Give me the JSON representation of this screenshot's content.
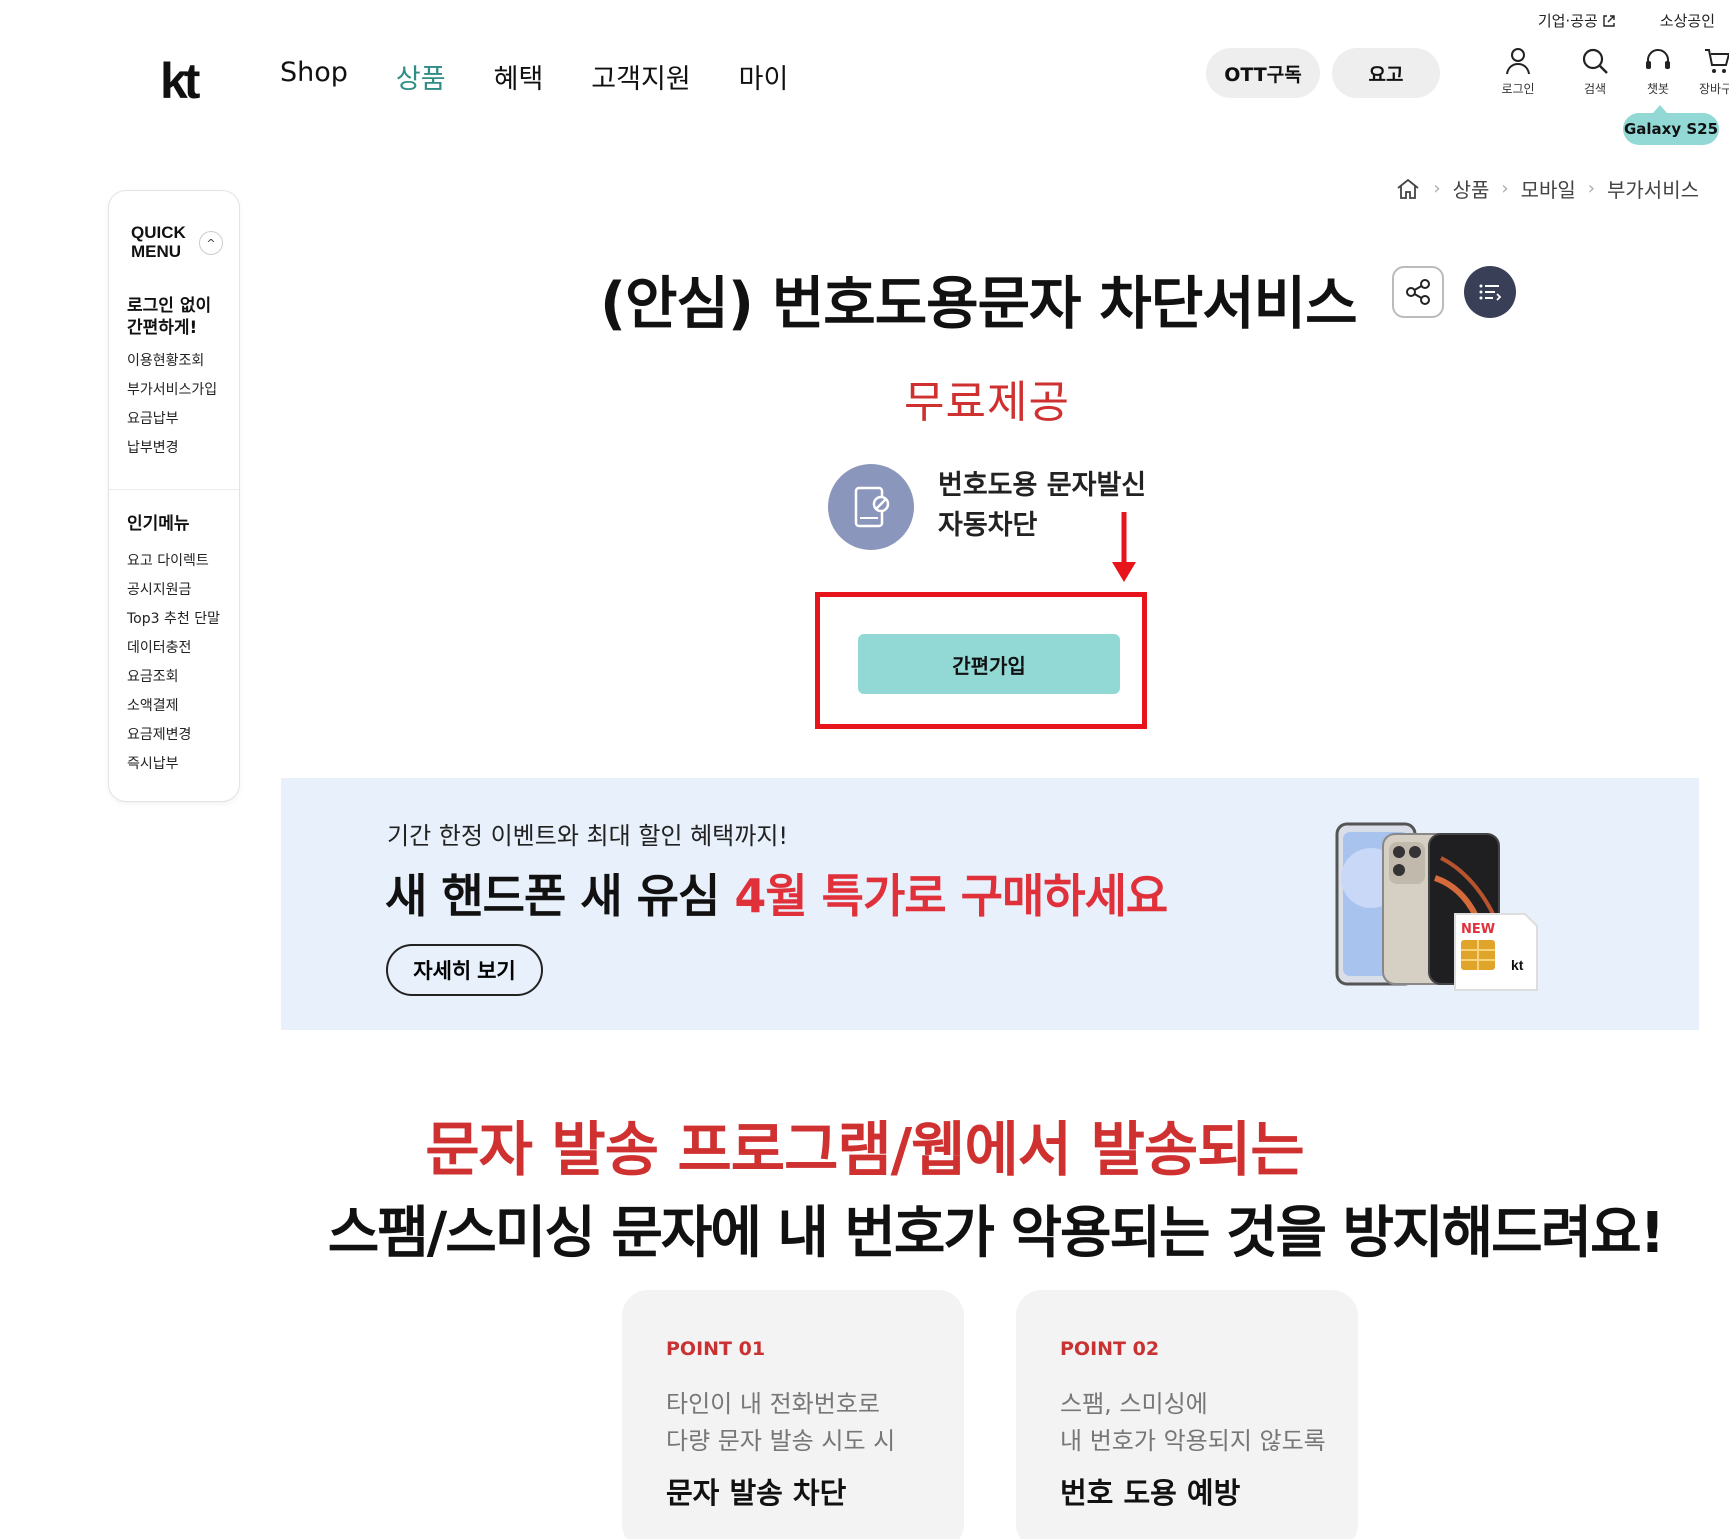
{
  "header": {
    "logo": "kt",
    "util_links": [
      "기업·공공",
      "소상공인"
    ],
    "nav": [
      "Shop",
      "상품",
      "혜택",
      "고객지원",
      "마이"
    ],
    "active_nav": "상품",
    "pill_buttons": [
      "OTT구독",
      "요고"
    ],
    "icon_menu": [
      {
        "label": "로그인",
        "icon": "user-icon"
      },
      {
        "label": "검색",
        "icon": "search-icon"
      },
      {
        "label": "챗봇",
        "icon": "headset-icon"
      },
      {
        "label": "장바구",
        "icon": "cart-icon"
      }
    ],
    "badge": "Galaxy S25"
  },
  "breadcrumb": [
    "상품",
    "모바일",
    "부가서비스"
  ],
  "quick_menu": {
    "title_line1": "QUICK",
    "title_line2": "MENU",
    "section1_title": "로그인 없이 간편하게!",
    "section1_items": [
      "이용현황조회",
      "부가서비스가입",
      "요금납부",
      "납부변경"
    ],
    "section2_title": "인기메뉴",
    "section2_items": [
      "요고 다이렉트",
      "공시지원금",
      "Top3 추천 단말",
      "데이터충전",
      "요금조회",
      "소액결제",
      "요금제변경",
      "즉시납부"
    ]
  },
  "product": {
    "title": "(안심) 번호도용문자 차단서비스",
    "price": "무료제공",
    "feature_line1": "번호도용 문자발신",
    "feature_line2": "자동차단",
    "join_label": "간편가입"
  },
  "banner": {
    "sub": "기간 한정 이벤트와 최대 할인 혜택까지!",
    "main_prefix": "새 핸드폰 새 유심 ",
    "main_accent": "4월 특가로 구매하세요",
    "button": "자세히 보기",
    "sim_new": "NEW",
    "sim_brand": "kt"
  },
  "section": {
    "headline_red": "문자 발송 프로그램/웹에서 발송되는",
    "headline_black": "스팸/스미싱 문자에 내 번호가 악용되는 것을 방지해드려요!"
  },
  "points": [
    {
      "label": "POINT 01",
      "desc1": "타인이 내 전화번호로",
      "desc2": "다량 문자 발송 시도 시",
      "title": "문자 발송 차단"
    },
    {
      "label": "POINT 02",
      "desc1": "스팸, 스미싱에",
      "desc2": "내 번호가 악용되지 않도록",
      "title": "번호 도용 예방"
    }
  ],
  "colors": {
    "brand_teal": "#2f8d86",
    "button_mint": "#92d9d6",
    "accent_red": "#cf3030",
    "highlight_red": "#e8141b",
    "banner_bg": "#e8f0fb"
  }
}
